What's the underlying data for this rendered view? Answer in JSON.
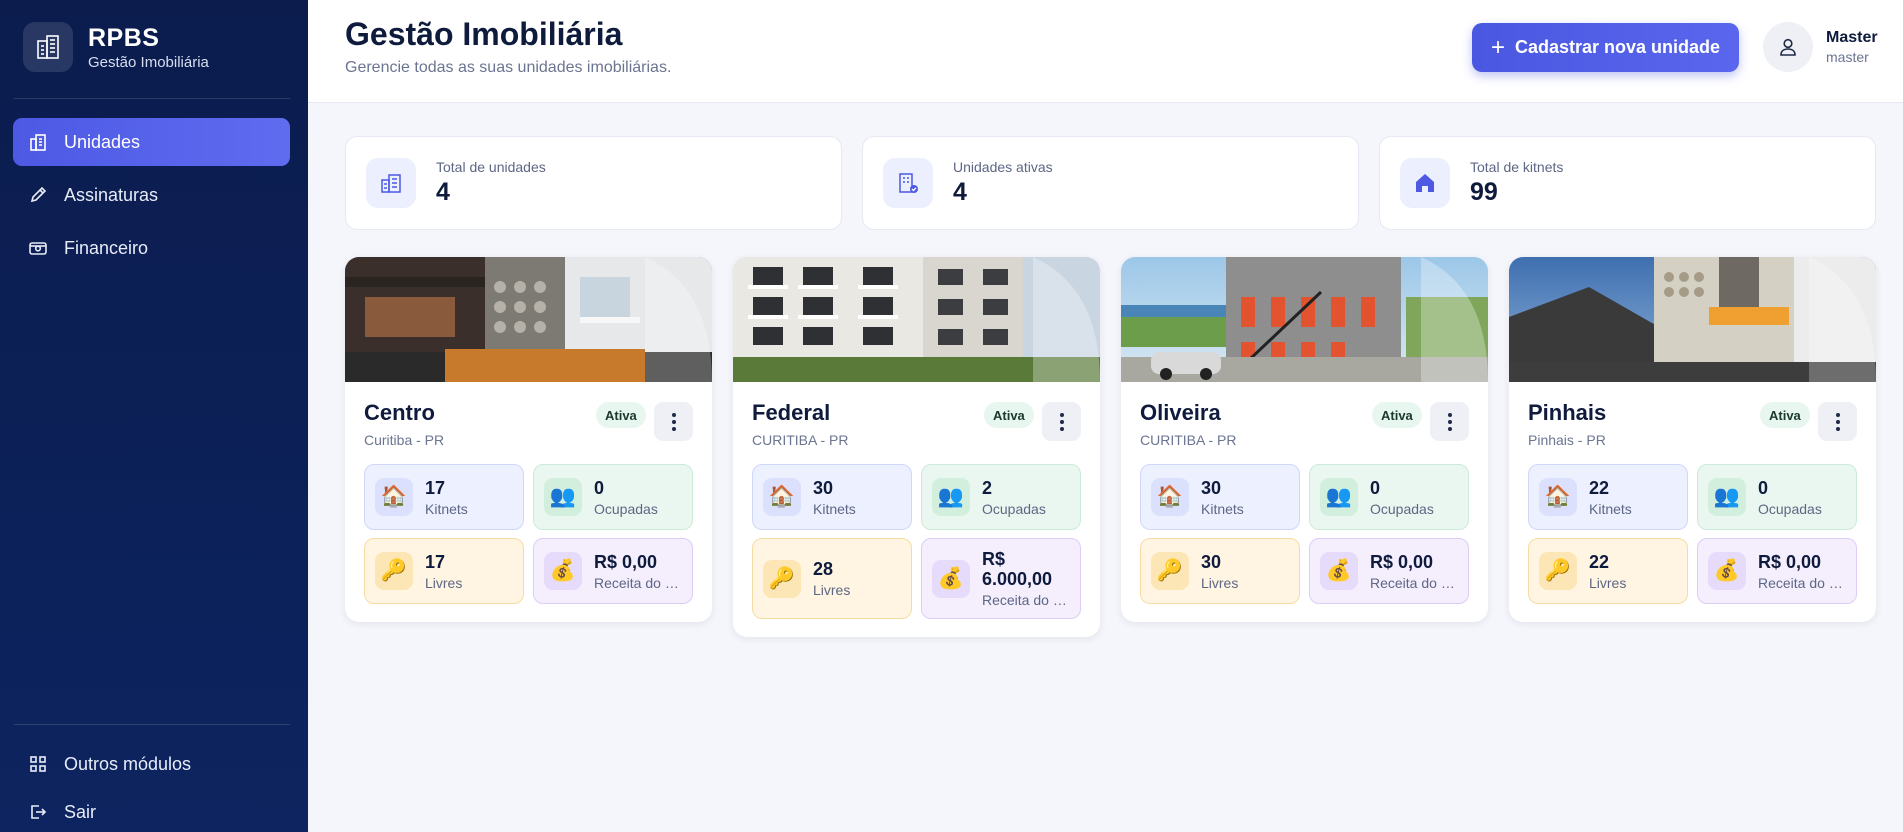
{
  "brand": {
    "name": "RPBS",
    "subtitle": "Gestão Imobiliária"
  },
  "sidebar": {
    "items": [
      {
        "label": "Unidades",
        "icon": "building-chart-icon",
        "active": true
      },
      {
        "label": "Assinaturas",
        "icon": "pen-icon",
        "active": false
      },
      {
        "label": "Financeiro",
        "icon": "money-icon",
        "active": false
      }
    ],
    "bottom": [
      {
        "label": "Outros módulos",
        "icon": "grid-icon"
      },
      {
        "label": "Sair",
        "icon": "logout-icon"
      }
    ]
  },
  "header": {
    "title": "Gestão Imobiliária",
    "subtitle": "Gerencie todas as suas unidades imobiliárias.",
    "new_button": "Cadastrar nova unidade",
    "user": {
      "name": "Master",
      "role": "master"
    }
  },
  "stats": [
    {
      "label": "Total de unidades",
      "value": "4",
      "icon": "building-chart-icon"
    },
    {
      "label": "Unidades ativas",
      "value": "4",
      "icon": "building-check-icon"
    },
    {
      "label": "Total de kitnets",
      "value": "99",
      "icon": "house-icon"
    }
  ],
  "units": [
    {
      "name": "Centro",
      "city": "Curitiba - PR",
      "status": "Ativa",
      "kitnets": "17",
      "kitnets_label": "Kitnets",
      "ocupadas": "0",
      "ocupadas_label": "Ocupadas",
      "livres": "17",
      "livres_label": "Livres",
      "receita": "R$ 0,00",
      "receita_label": "Receita do mês"
    },
    {
      "name": "Federal",
      "city": "CURITIBA - PR",
      "status": "Ativa",
      "kitnets": "30",
      "kitnets_label": "Kitnets",
      "ocupadas": "2",
      "ocupadas_label": "Ocupadas",
      "livres": "28",
      "livres_label": "Livres",
      "receita": "R$ 6.000,00",
      "receita_label": "Receita do mês"
    },
    {
      "name": "Oliveira",
      "city": "CURITIBA - PR",
      "status": "Ativa",
      "kitnets": "30",
      "kitnets_label": "Kitnets",
      "ocupadas": "0",
      "ocupadas_label": "Ocupadas",
      "livres": "30",
      "livres_label": "Livres",
      "receita": "R$ 0,00",
      "receita_label": "Receita do mês"
    },
    {
      "name": "Pinhais",
      "city": "Pinhais - PR",
      "status": "Ativa",
      "kitnets": "22",
      "kitnets_label": "Kitnets",
      "ocupadas": "0",
      "ocupadas_label": "Ocupadas",
      "livres": "22",
      "livres_label": "Livres",
      "receita": "R$ 0,00",
      "receita_label": "Receita do mês"
    }
  ],
  "colors": {
    "sidebar_bg": "#0b1c4d",
    "accent": "#4d59e4",
    "badge_bg": "#e7f6ee"
  }
}
